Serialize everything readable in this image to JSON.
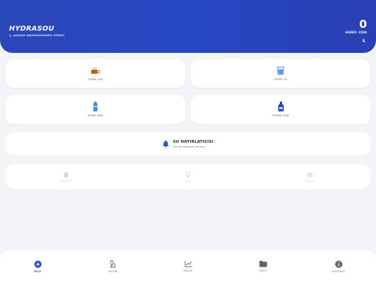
{
  "header": {
    "title": "HYDRASOU",
    "subtitle": "AKŞAMI HEJMİNAHUMDU SÜRECİ",
    "count": "0",
    "goal": "HEDEF: 2500"
  },
  "drinks": [
    {
      "label": "200ML ÇAY",
      "icon": "tea-cup-icon"
    },
    {
      "label": "200ML SU",
      "icon": "water-glass-icon"
    },
    {
      "label": "500ML ŞİŞE",
      "icon": "water-bottle-icon"
    },
    {
      "label": "1000ML ŞİŞE",
      "icon": "large-bottle-icon"
    }
  ],
  "reminder": {
    "title": "SU HATIRLATICISI",
    "subtitle": "Her 90 dakikada bildirim"
  },
  "extras": [
    {
      "label": "KONUMLAR",
      "icon": "hand-icon"
    },
    {
      "label": "İPUCU",
      "icon": "lightbulb-icon"
    },
    {
      "label": "AYARLAR",
      "icon": "gear-icon"
    }
  ],
  "nav": [
    {
      "label": "EKLE",
      "icon": "plus-circle-icon",
      "active": true
    },
    {
      "label": "BUGÜN",
      "icon": "calendar-icon",
      "active": false
    },
    {
      "label": "ANALİZ",
      "icon": "chart-icon",
      "active": false
    },
    {
      "label": "ARŞİV",
      "icon": "folder-icon",
      "active": false
    },
    {
      "label": "HAKKINDA",
      "icon": "info-icon",
      "active": false
    }
  ],
  "colors": {
    "accent": "#2d55d8",
    "header_start": "#2a47b8",
    "header_end": "#2a3fb3"
  }
}
